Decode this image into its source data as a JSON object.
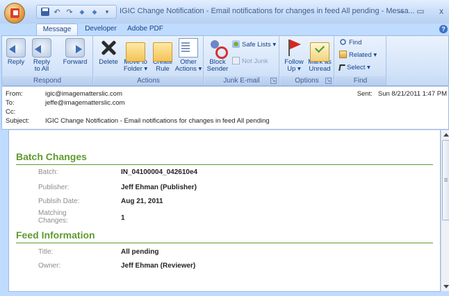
{
  "window": {
    "title": "IGIC Change Notification - Email notifications for changes in  feed All pending - Messa...",
    "minimize": "–",
    "maximize": "▭",
    "close": "x"
  },
  "quick_access": {
    "undo": "↶",
    "redo": "↷",
    "up": "◆",
    "down": "◆",
    "more": "▾"
  },
  "tabs": [
    {
      "label": "Message",
      "active": true
    },
    {
      "label": "Developer",
      "active": false
    },
    {
      "label": "Adobe PDF",
      "active": false
    }
  ],
  "help_label": "?",
  "ribbon": {
    "respond": {
      "label": "Respond",
      "reply": "Reply",
      "reply_all_1": "Reply",
      "reply_all_2": "to All",
      "forward": "Forward"
    },
    "actions": {
      "label": "Actions",
      "delete": "Delete",
      "move_1": "Move to",
      "move_2": "Folder ▾",
      "create_1": "Create",
      "create_2": "Rule",
      "other_1": "Other",
      "other_2": "Actions ▾"
    },
    "junk": {
      "label": "Junk E-mail",
      "block_1": "Block",
      "block_2": "Sender",
      "safe_lists": "Safe Lists ▾",
      "not_junk": "Not Junk"
    },
    "options": {
      "label": "Options",
      "follow_1": "Follow",
      "follow_2": "Up ▾",
      "mark_1": "Mark as",
      "mark_2": "Unread"
    },
    "find": {
      "label": "Find",
      "find": "Find",
      "related": "Related ▾",
      "select": "Select ▾"
    },
    "launcher": "↘"
  },
  "header": {
    "from_label": "From:",
    "from": "igic@imagematterslic.com",
    "to_label": "To:",
    "to": "jeffe@imagematterslic.com",
    "cc_label": "Cc:",
    "cc": "",
    "subject_label": "Subject:",
    "subject": "IGIC Change Notification - Email notifications for changes in  feed All pending",
    "sent_label": "Sent:",
    "sent": "Sun 8/21/2011 1:47 PM"
  },
  "body": {
    "batch_section": "Batch Changes",
    "batch_fields": [
      {
        "label": "Batch:",
        "value": "IN_04100004_042610e4"
      },
      {
        "label": "Publisher:",
        "value": "Jeff Ehman (Publisher)"
      },
      {
        "label": "Publsih Date:",
        "value": "Aug 21, 2011"
      },
      {
        "label": "Matching Changes:",
        "value": "1"
      }
    ],
    "feed_section": "Feed Information",
    "feed_fields": [
      {
        "label": "Title:",
        "value": "All pending"
      },
      {
        "label": "Owner:",
        "value": "Jeff Ehman (Reviewer)"
      }
    ]
  }
}
